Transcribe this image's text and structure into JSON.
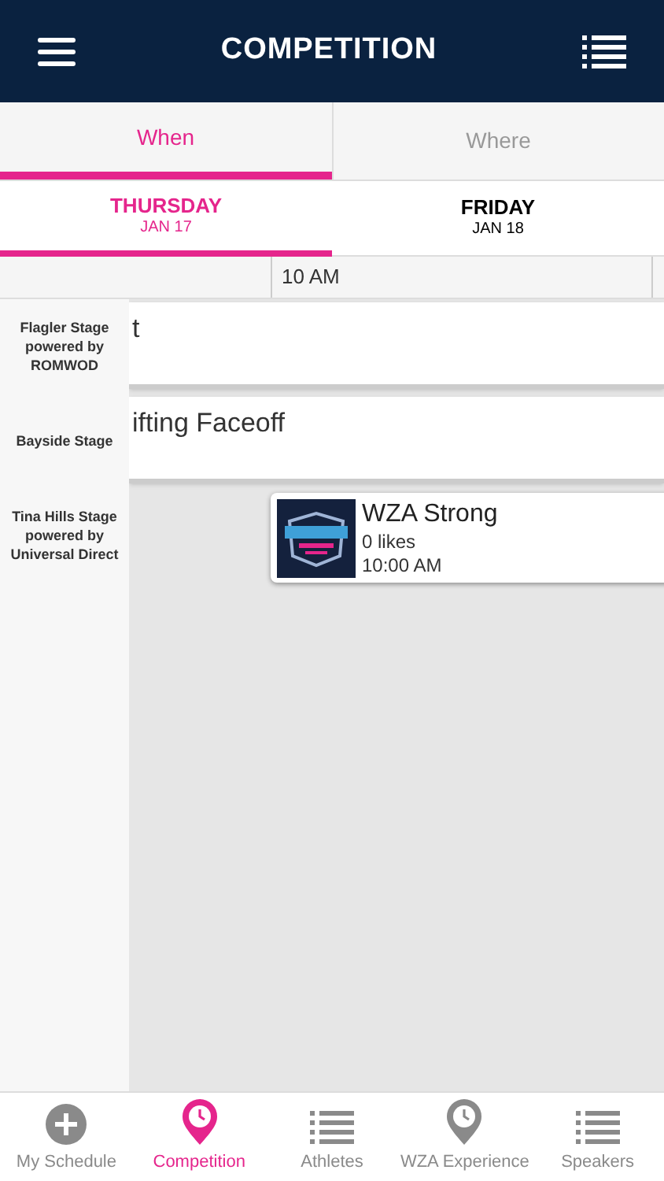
{
  "header": {
    "title": "COMPETITION"
  },
  "view_tabs": [
    {
      "label": "When",
      "selected": true
    },
    {
      "label": "Where",
      "selected": false
    }
  ],
  "day_tabs": [
    {
      "day": "THURSDAY",
      "date": "JAN 17",
      "selected": true
    },
    {
      "day": "FRIDAY",
      "date": "JAN 18",
      "selected": false
    }
  ],
  "time_header": [
    "10 AM"
  ],
  "stages": [
    {
      "name": "Flagler Stage powered by ROMWOD",
      "event": {
        "title": "t",
        "kind": "partial"
      }
    },
    {
      "name": "Bayside Stage",
      "event": {
        "title": "ifting Faceoff",
        "kind": "partial"
      }
    },
    {
      "name": "Tina Hills Stage powered by Universal Direct",
      "event": {
        "title": "WZA Strong",
        "likes": "0 likes",
        "time": "10:00 AM",
        "kind": "card"
      }
    }
  ],
  "bottom_nav": [
    {
      "label": "My Schedule",
      "kind": "plus",
      "selected": false
    },
    {
      "label": "Competition",
      "kind": "pin",
      "selected": true
    },
    {
      "label": "Athletes",
      "kind": "list",
      "selected": false
    },
    {
      "label": "WZA Experience",
      "kind": "pin",
      "selected": false
    },
    {
      "label": "Speakers",
      "kind": "list",
      "selected": false
    }
  ]
}
